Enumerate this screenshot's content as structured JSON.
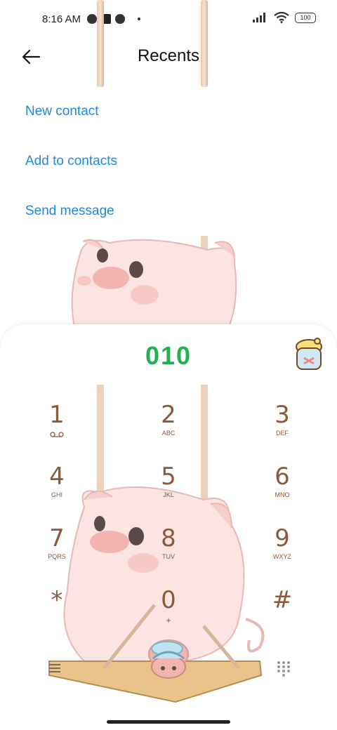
{
  "status_bar": {
    "time": "8:16 AM",
    "battery": "100",
    "icons": [
      "app-notification-icon",
      "media-square-icon",
      "app-notification-icon",
      "dot-icon",
      "signal-icon",
      "wifi-icon",
      "battery-icon"
    ]
  },
  "header": {
    "title": "Recents",
    "back_icon": "arrow-left-icon"
  },
  "actions": {
    "new_contact": "New contact",
    "add_to_contacts": "Add to contacts",
    "send_message": "Send message"
  },
  "dialer": {
    "number": "010",
    "accent_color": "#22b14c",
    "keys": [
      {
        "digit": "1",
        "letters": "voicemail"
      },
      {
        "digit": "2",
        "letters": "ABC"
      },
      {
        "digit": "3",
        "letters": "DEF"
      },
      {
        "digit": "4",
        "letters": "GHI"
      },
      {
        "digit": "5",
        "letters": "JKL"
      },
      {
        "digit": "6",
        "letters": "MNO"
      },
      {
        "digit": "7",
        "letters": "PQRS"
      },
      {
        "digit": "8",
        "letters": "TUV"
      },
      {
        "digit": "9",
        "letters": "WXYZ"
      },
      {
        "digit": "*",
        "letters": ""
      },
      {
        "digit": "0",
        "letters": "+"
      },
      {
        "digit": "#",
        "letters": ""
      }
    ],
    "bottom_left_icon": "menu-icon",
    "bottom_right_icon": "keypad-icon",
    "call_icon": "phone-call-icon"
  },
  "colors": {
    "link": "#1e88e5",
    "key_text": "#8a5a3c"
  }
}
